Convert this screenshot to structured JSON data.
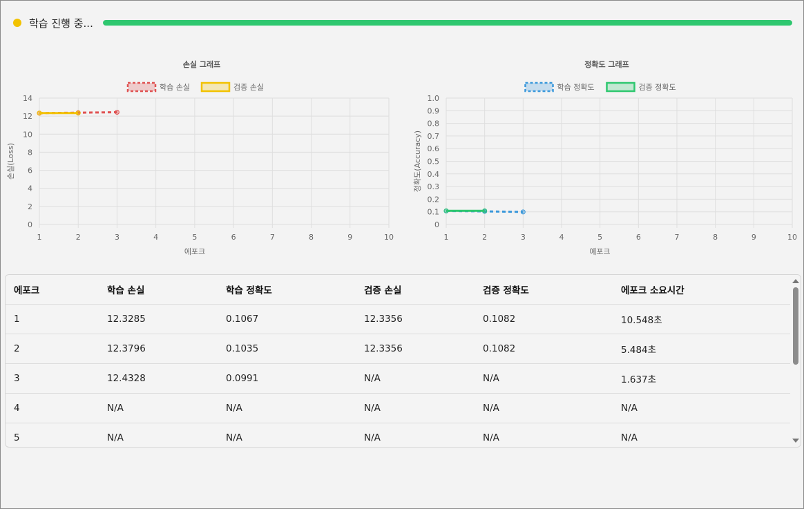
{
  "status": {
    "text": "학습 진행 중...",
    "progress": 1.0,
    "dot_color": "#f2c200",
    "bar_color": "#2ec76f"
  },
  "charts": [
    {
      "id": "loss",
      "chart_data": {
        "type": "line",
        "title": "손실 그래프",
        "xlabel": "에포크",
        "ylabel": "손실(Loss)",
        "x_ticks": [
          "1",
          "2",
          "3",
          "4",
          "5",
          "6",
          "7",
          "8",
          "9",
          "10"
        ],
        "y_ticks": [
          "0",
          "2",
          "4",
          "6",
          "8",
          "10",
          "12",
          "14"
        ],
        "xlim": [
          1,
          10
        ],
        "ylim": [
          0,
          14
        ],
        "grid": true,
        "legend_position": "top",
        "series": [
          {
            "name": "학습 손실",
            "x": [
              1,
              2,
              3
            ],
            "y": [
              12.3285,
              12.3796,
              12.4328
            ],
            "color": "#e05252",
            "dashed": true
          },
          {
            "name": "검증 손실",
            "x": [
              1,
              2
            ],
            "y": [
              12.3356,
              12.3356
            ],
            "color": "#f2c200",
            "dashed": false
          }
        ]
      }
    },
    {
      "id": "accuracy",
      "chart_data": {
        "type": "line",
        "title": "정확도 그래프",
        "xlabel": "에포크",
        "ylabel": "정확도(Accuracy)",
        "x_ticks": [
          "1",
          "2",
          "3",
          "4",
          "5",
          "6",
          "7",
          "8",
          "9",
          "10"
        ],
        "y_ticks": [
          "0",
          "0.1",
          "0.2",
          "0.3",
          "0.4",
          "0.5",
          "0.6",
          "0.7",
          "0.8",
          "0.9",
          "1.0"
        ],
        "xlim": [
          1,
          10
        ],
        "ylim": [
          0,
          1
        ],
        "grid": true,
        "legend_position": "top",
        "series": [
          {
            "name": "학습 정확도",
            "x": [
              1,
              2,
              3
            ],
            "y": [
              0.1067,
              0.1035,
              0.0991
            ],
            "color": "#3a98db",
            "dashed": true
          },
          {
            "name": "검증 정확도",
            "x": [
              1,
              2
            ],
            "y": [
              0.1082,
              0.1082
            ],
            "color": "#2ec76f",
            "dashed": false
          }
        ]
      }
    }
  ],
  "table": {
    "headers": [
      "에포크",
      "학습 손실",
      "학습 정확도",
      "검증 손실",
      "검증 정확도",
      "에포크 소요시간"
    ],
    "rows": [
      [
        "1",
        "12.3285",
        "0.1067",
        "12.3356",
        "0.1082",
        "10.548초"
      ],
      [
        "2",
        "12.3796",
        "0.1035",
        "12.3356",
        "0.1082",
        "5.484초"
      ],
      [
        "3",
        "12.4328",
        "0.0991",
        "N/A",
        "N/A",
        "1.637초"
      ],
      [
        "4",
        "N/A",
        "N/A",
        "N/A",
        "N/A",
        "N/A"
      ],
      [
        "5",
        "N/A",
        "N/A",
        "N/A",
        "N/A",
        "N/A"
      ]
    ]
  }
}
